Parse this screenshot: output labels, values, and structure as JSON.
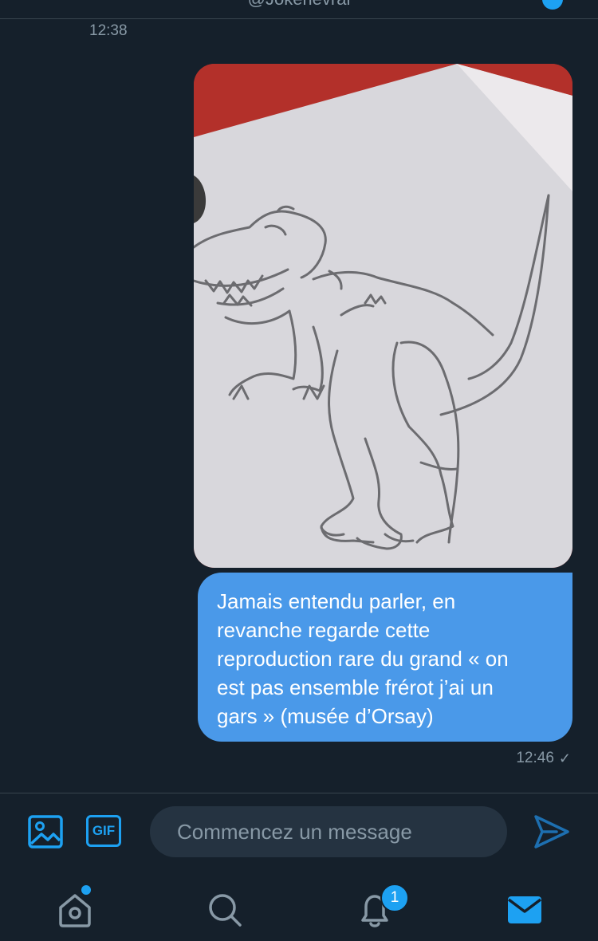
{
  "header": {
    "handle": "@Jokerlevrai",
    "top_timestamp": "12:38"
  },
  "messages": [
    {
      "type": "image",
      "icon": "trex-drawing-photo"
    },
    {
      "type": "text",
      "lines": [
        "Jamais entendu parler, en",
        "revanche regarde cette",
        "reproduction rare du grand « on",
        "est pas ensemble frérot j’ai un",
        "gars » (musée d’Orsay)"
      ],
      "timestamp": "12:46",
      "status_icon": "check-icon"
    }
  ],
  "compose": {
    "placeholder": "Commencez un message",
    "value": "",
    "gif_label": "GIF",
    "icons": [
      "media-icon",
      "gif-icon",
      "send-icon"
    ]
  },
  "bottom_nav": {
    "items": [
      "home-icon",
      "search-icon",
      "notifications-icon",
      "messages-icon"
    ],
    "notification_count": "1"
  },
  "colors": {
    "background": "#15202b",
    "accent": "#1da1f2",
    "bubble": "#4a99e9",
    "muted": "#8899a6"
  }
}
